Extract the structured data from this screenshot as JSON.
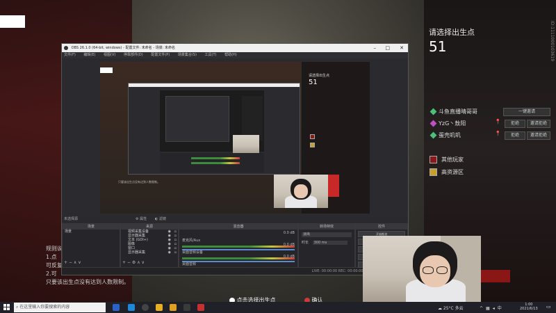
{
  "game": {
    "spawn_title": "请选择出生点",
    "spawn_count": "51",
    "players": [
      {
        "name": "斗鱼直播晴哥哥",
        "color": "#4cc07a",
        "action": "一键邀请"
      },
      {
        "name": "YzG丶敖阳",
        "color": "#c050c0",
        "actions": [
          "拒绝",
          "邀请拒绝"
        ]
      },
      {
        "name": "蛋壳叽叽",
        "color": "#4cc07a",
        "actions": [
          "拒绝",
          "邀请拒绝"
        ]
      }
    ],
    "legend": [
      {
        "label": "其他玩家",
        "color": "#8a1a1a"
      },
      {
        "label": "高资源区",
        "color": "#c8a030"
      }
    ],
    "vertical_id": "ID:1111000103619",
    "rules": [
      "规则说",
      "1.点",
      "可反复",
      "2.可",
      "只要该出生点没有达到人数限制。"
    ],
    "bottom_hint_1": "点击选择出生点",
    "bottom_hint_2": "确认"
  },
  "obs": {
    "title": "OBS 26.1.0 (64-bit, windows) - 配置文件: 未命名 - 场景: 未命名",
    "menu": [
      "文件(F)",
      "编辑(E)",
      "视图(V)",
      "停靠部件(D)",
      "配置文件(P)",
      "场景集合(S)",
      "工具(T)",
      "帮助(H)"
    ],
    "no_source": "未选择源",
    "props_label": "属性",
    "filters_label": "滤镜",
    "docks": {
      "scenes": "场景",
      "sources": "来源",
      "mixer": "混音器",
      "transitions": "转场特效",
      "controls": "控件"
    },
    "scene_item": "场景",
    "source_items": [
      "视频采集设备",
      "显示器采集",
      "文本 (GDI+)",
      "图像",
      "窗口",
      "显示器采集"
    ],
    "mixer_channels": [
      {
        "name": "麦克风/Aux",
        "db": "0.0 dB"
      },
      {
        "name": "桌面音频设备",
        "db": "0.0 dB"
      },
      {
        "name": "桌面音频",
        "db": "0.0 dB"
      }
    ],
    "transition": "淡出",
    "duration_label": "时长",
    "duration_value": "300 ms",
    "controls": [
      "开始推流",
      "开始录制",
      "启动虚拟摄像机",
      "工作室模式",
      "设置",
      "退出"
    ],
    "status": "LIVE: 00:00:00   REC: 00:00:00   CPU: 3.4%, 30.00 fps"
  },
  "taskbar": {
    "search_placeholder": "在这里输入你要搜索的内容",
    "weather": "25°C 多云",
    "time": "1:00",
    "date": "2021/6/13"
  }
}
